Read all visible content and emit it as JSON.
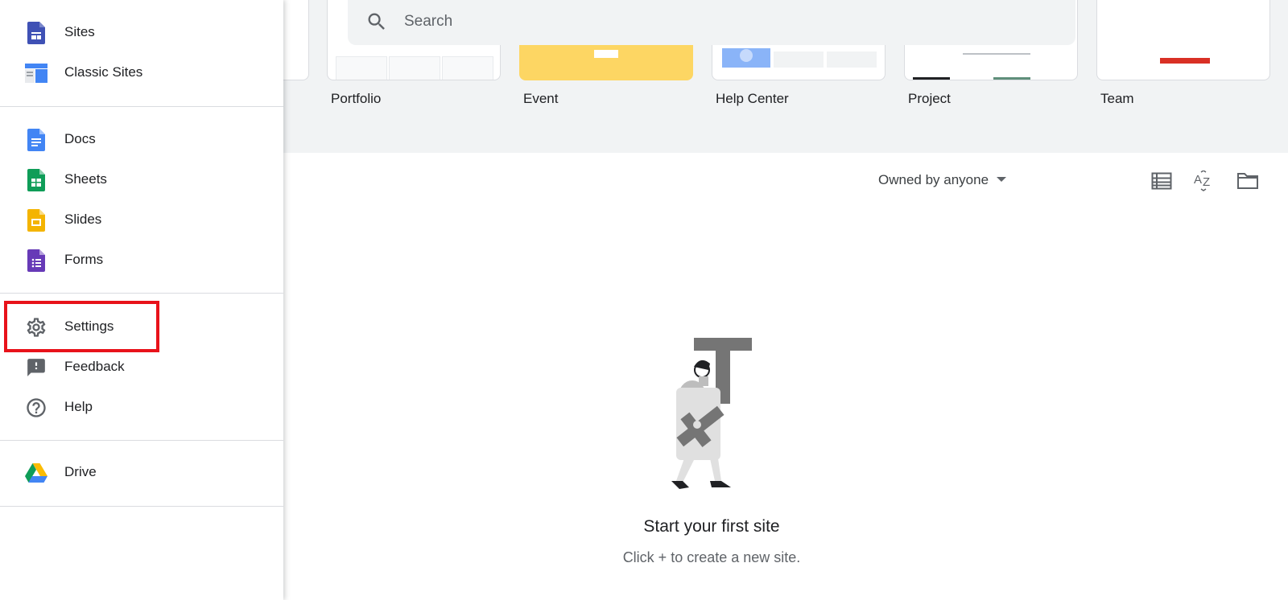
{
  "search": {
    "placeholder": "Search"
  },
  "templates": [
    {
      "label": "Portfolio",
      "thumb_color": "#ffffff"
    },
    {
      "label": "Event",
      "thumb_color": "#fdd663"
    },
    {
      "label": "Help Center",
      "thumb_color": "#ffffff"
    },
    {
      "label": "Project",
      "thumb_color": "#ffffff"
    },
    {
      "label": "Team",
      "thumb_color": "#ffffff"
    }
  ],
  "toolbar": {
    "owner_filter": "Owned by anyone",
    "list_view_icon": "list-view-icon",
    "sort_icon": "sort-az-icon",
    "folder_icon": "folder-icon"
  },
  "empty_state": {
    "title": "Start your first site",
    "subtitle": "Click + to create a new site."
  },
  "drawer": {
    "group1": [
      {
        "label": "Sites",
        "icon": "sites-icon",
        "color": "#3f51b5"
      },
      {
        "label": "Classic Sites",
        "icon": "classic-sites-icon",
        "color": "#4285f4"
      }
    ],
    "group2": [
      {
        "label": "Docs",
        "icon": "docs-icon",
        "color": "#4285f4"
      },
      {
        "label": "Sheets",
        "icon": "sheets-icon",
        "color": "#0f9d58"
      },
      {
        "label": "Slides",
        "icon": "slides-icon",
        "color": "#f4b400"
      },
      {
        "label": "Forms",
        "icon": "forms-icon",
        "color": "#673ab7"
      }
    ],
    "group3": [
      {
        "label": "Settings",
        "icon": "gear-icon",
        "color": "#5f6368"
      },
      {
        "label": "Feedback",
        "icon": "feedback-icon",
        "color": "#5f6368"
      },
      {
        "label": "Help",
        "icon": "help-icon",
        "color": "#5f6368"
      }
    ],
    "group4": [
      {
        "label": "Drive",
        "icon": "drive-icon",
        "color": "#1fa463"
      }
    ]
  },
  "highlight_color": "#e8121a"
}
